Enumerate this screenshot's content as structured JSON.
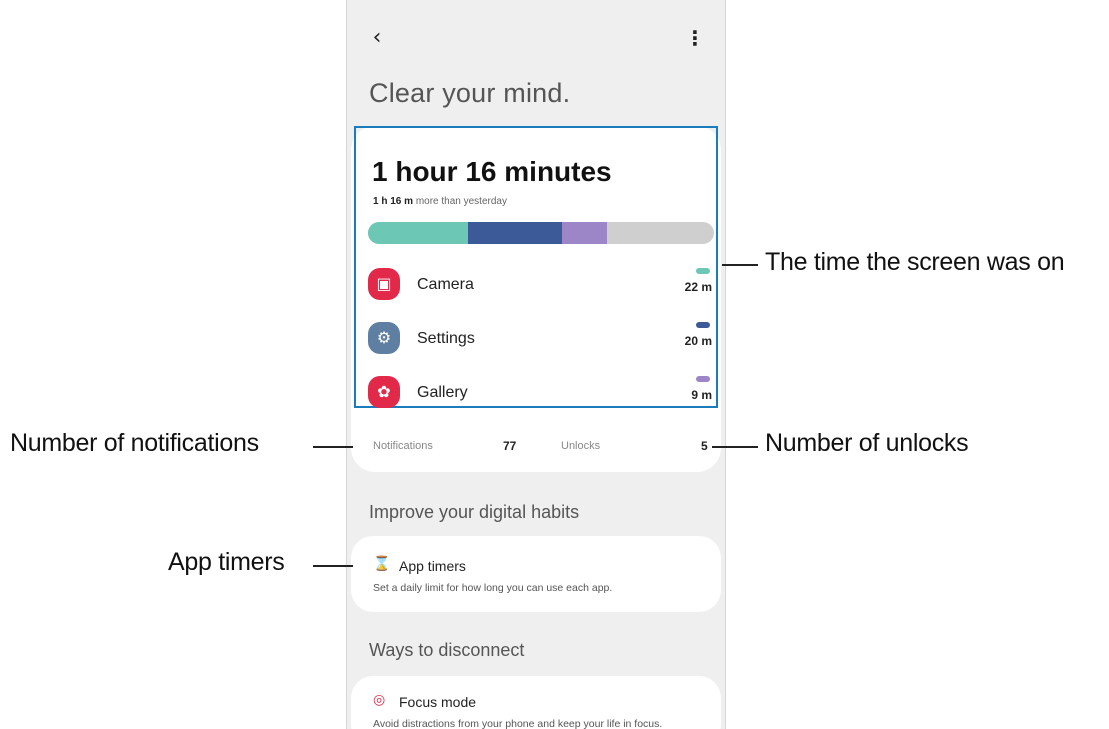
{
  "header": {
    "back_icon": "back-arrow-icon",
    "more_icon": "more-vertical-icon",
    "title": "Clear your mind."
  },
  "summary": {
    "total_time": "1 hour 16 minutes",
    "compare_bold": "1 h 16 m",
    "compare_rest": "more than yesterday"
  },
  "usage_bar": {
    "segments": [
      {
        "app": "Camera",
        "color": "#6cc7b5",
        "fraction": 0.29
      },
      {
        "app": "Settings",
        "color": "#3d5a98",
        "fraction": 0.27
      },
      {
        "app": "Gallery",
        "color": "#9d86c7",
        "fraction": 0.13
      }
    ],
    "remainder_color": "#cfcfcf"
  },
  "apps": [
    {
      "name": "Camera",
      "time": "22 m",
      "icon": "camera-icon",
      "icon_color": "#e2294a",
      "pill_color": "#6cc7b5"
    },
    {
      "name": "Settings",
      "time": "20 m",
      "icon": "gear-icon",
      "icon_color": "#5e7fa1",
      "pill_color": "#3d5a98"
    },
    {
      "name": "Gallery",
      "time": "9 m",
      "icon": "flower-icon",
      "icon_color": "#e2294a",
      "pill_color": "#9d86c7"
    }
  ],
  "stats": {
    "notifications_label": "Notifications",
    "notifications_value": "77",
    "unlocks_label": "Unlocks",
    "unlocks_value": "5"
  },
  "improve": {
    "section_title": "Improve your digital habits",
    "app_timers_label": "App timers",
    "app_timers_icon": "hourglass-icon",
    "app_timers_desc": "Set a daily limit for how long you can use each app."
  },
  "disconnect": {
    "section_title": "Ways to disconnect",
    "focus_label": "Focus mode",
    "focus_icon": "target-icon",
    "focus_desc": "Avoid distractions from your phone and keep your life in focus."
  },
  "callouts": {
    "screen_time": "The time the screen was on",
    "notifications": "Number of notifications",
    "unlocks": "Number of unlocks",
    "app_timers": "App timers"
  }
}
